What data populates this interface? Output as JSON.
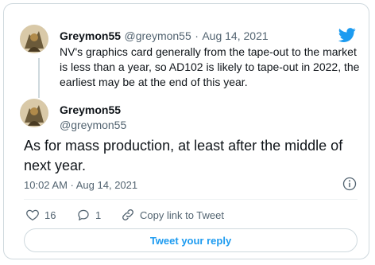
{
  "colors": {
    "accent": "#1d9bf0",
    "text": "#0f1419",
    "muted": "#536471",
    "border": "#cfd9de"
  },
  "parent_tweet": {
    "display_name": "Greymon55",
    "handle": "@greymon55",
    "separator": "·",
    "date": "Aug 14, 2021",
    "text": "NV's graphics card generally from the tape-out to the market is less than a year, so AD102 is likely to tape-out in 2022, the earliest may be at the end of this year.",
    "avatar_icon": "avatar-image"
  },
  "main_tweet": {
    "display_name": "Greymon55",
    "handle": "@greymon55",
    "text": "As for mass production, at least after the middle of next year.",
    "timestamp": "10:02 AM · Aug 14, 2021",
    "avatar_icon": "avatar-image"
  },
  "actions": {
    "like_count": "16",
    "reply_count": "1",
    "copy_link_label": "Copy link to Tweet",
    "like_icon": "heart-icon",
    "reply_icon": "speech-bubble-icon",
    "link_icon": "link-icon",
    "info_icon": "info-icon"
  },
  "reply_button_label": "Tweet your reply",
  "brand_icon": "twitter-bird-icon"
}
